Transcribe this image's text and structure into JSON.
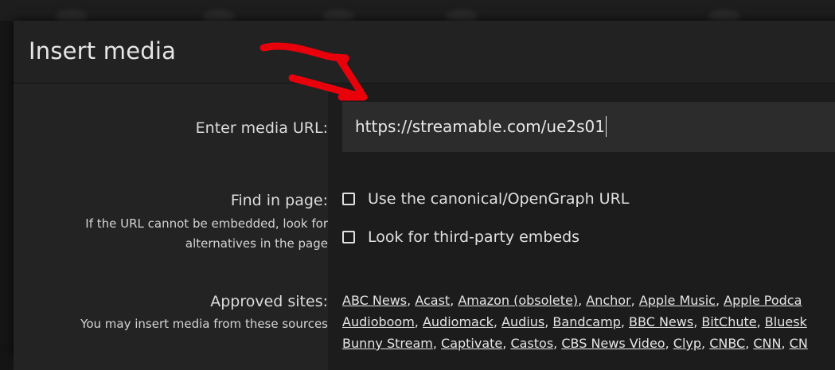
{
  "dialog": {
    "title": "Insert media"
  },
  "media_url": {
    "label": "Enter media URL:",
    "value": "https://streamable.com/ue2s01"
  },
  "find_in_page": {
    "label": "Find in page:",
    "hint_line1": "If the URL cannot be embedded, look for",
    "hint_line2": "alternatives in the page",
    "options": [
      {
        "label": "Use the canonical/OpenGraph URL",
        "checked": false
      },
      {
        "label": "Look for third-party embeds",
        "checked": false
      }
    ]
  },
  "approved_sites": {
    "label": "Approved sites:",
    "hint": "You may insert media from these sources",
    "rows": [
      [
        "ABC News",
        "Acast",
        "Amazon (obsolete)",
        "Anchor",
        "Apple Music",
        "Apple Podca"
      ],
      [
        "Audioboom",
        "Audiomack",
        "Audius",
        "Bandcamp",
        "BBC News",
        "BitChute",
        "Bluesk"
      ],
      [
        "Bunny Stream",
        "Captivate",
        "Castos",
        "CBS News Video",
        "Clyp",
        "CNBC",
        "CNN",
        "CN"
      ]
    ]
  },
  "annotation": {
    "arrow_color": "#e8000b"
  }
}
